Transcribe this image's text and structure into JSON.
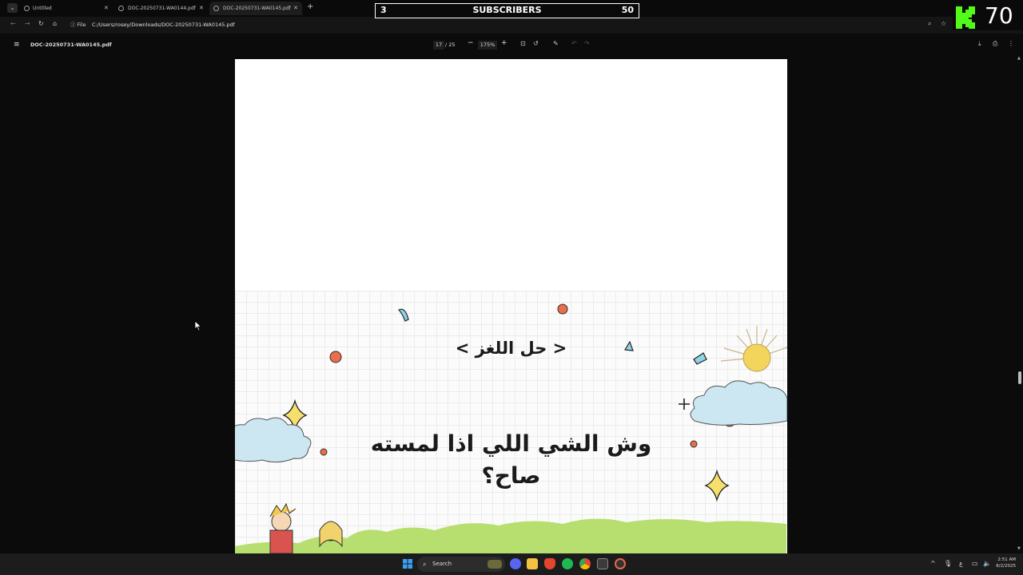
{
  "tabs": [
    {
      "label": "Untitled",
      "active": false
    },
    {
      "label": "DOC-20250731-WA0144.pdf",
      "active": false
    },
    {
      "label": "DOC-20250731-WA0145.pdf",
      "active": true
    }
  ],
  "address_bar": {
    "chip": "File",
    "url": "C:/Users/rosey/Downloads/DOC-20250731-WA0145.pdf"
  },
  "subscriber_goal": {
    "current": "3",
    "label": "SUBSCRIBERS",
    "goal": "50"
  },
  "kick_widget": {
    "count": "70",
    "brand_color": "#53fc18"
  },
  "pdf_toolbar": {
    "title": "DOC-20250731-WA0145.pdf",
    "page_current": "17",
    "page_total": "/ 25",
    "zoom": "175%"
  },
  "pdf_page": {
    "riddle_title": "< حل اللغز >",
    "riddle_question": "وش الشي اللي اذا لمسته صاح؟"
  },
  "taskbar": {
    "search_placeholder": "Search"
  },
  "clock": {
    "time": "2:51 AM",
    "date": "8/2/2025"
  }
}
